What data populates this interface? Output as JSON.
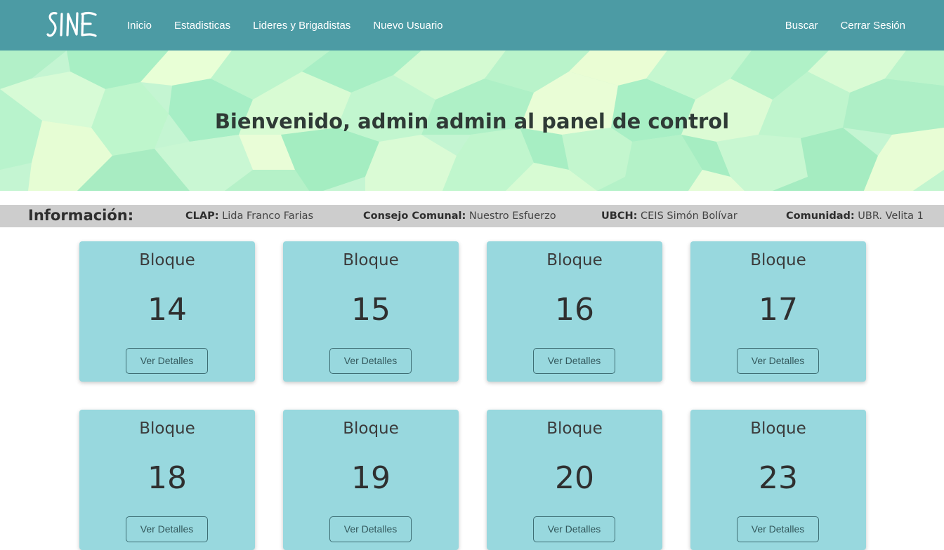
{
  "navbar": {
    "brand": "SINE",
    "left_links": [
      "Inicio",
      "Estadisticas",
      "Lideres y Brigadistas",
      "Nuevo Usuario"
    ],
    "right_links": [
      "Buscar",
      "Cerrar Sesión"
    ],
    "background_color": "#4c9ba4"
  },
  "hero": {
    "title": "Bienvenido, admin admin al panel de control"
  },
  "info": {
    "heading": "Información:",
    "clap_label": "CLAP:",
    "clap_value": "Lida Franco Farias",
    "consejo_label": "Consejo Comunal:",
    "consejo_value": "Nuestro Esfuerzo",
    "ubch_label": "UBCH:",
    "ubch_value": "CEIS Simón Bolívar",
    "comunidad_label": "Comunidad:",
    "comunidad_value": "UBR. Velita 1"
  },
  "cards": [
    {
      "label": "Bloque",
      "number": "14",
      "button": "Ver Detalles"
    },
    {
      "label": "Bloque",
      "number": "15",
      "button": "Ver Detalles"
    },
    {
      "label": "Bloque",
      "number": "16",
      "button": "Ver Detalles"
    },
    {
      "label": "Bloque",
      "number": "17",
      "button": "Ver Detalles"
    },
    {
      "label": "Bloque",
      "number": "18",
      "button": "Ver Detalles"
    },
    {
      "label": "Bloque",
      "number": "19",
      "button": "Ver Detalles"
    },
    {
      "label": "Bloque",
      "number": "20",
      "button": "Ver Detalles"
    },
    {
      "label": "Bloque",
      "number": "23",
      "button": "Ver Detalles"
    }
  ],
  "colors": {
    "card_background": "#98d8de",
    "info_bar": "#cdcdcd",
    "hero_mint": "#c4f5d2"
  }
}
